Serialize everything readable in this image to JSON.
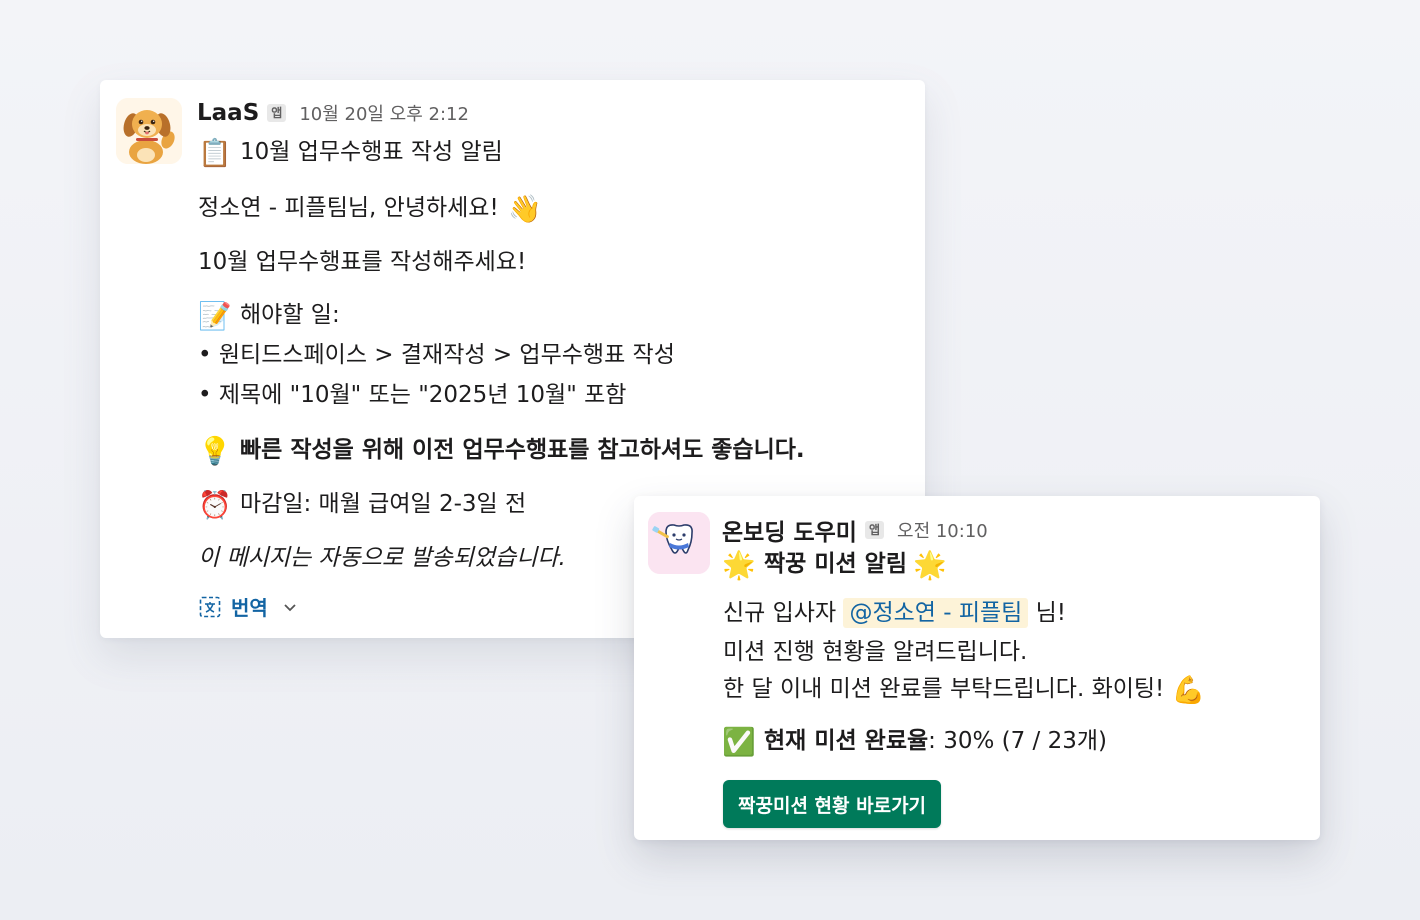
{
  "laas": {
    "sender": "LaaS",
    "app_badge": "앱",
    "time": "10월 20일 오후 2:12",
    "title_emoji": "📋",
    "title": "10월 업무수행표 작성 알림",
    "greeting": "정소연 - 피플팀님, 안녕하세요!",
    "greeting_emoji": "👋",
    "request": "10월 업무수행표를 작성해주세요!",
    "todo_emoji": "📝",
    "todo_label": "해야할 일:",
    "bullets": [
      "• 원티드스페이스 > 결재작성 > 업무수행표 작성",
      "• 제목에 \"10월\" 또는 \"2025년 10월\" 포함"
    ],
    "tip_emoji": "💡",
    "tip": "빠른 작성을 위해 이전 업무수행표를 참고하셔도 좋습니다.",
    "deadline_emoji": "⏰",
    "deadline": "마감일: 매월 급여일 2-3일 전",
    "auto_note": "이 메시지는 자동으로 발송되었습니다.",
    "translate_label": "번역",
    "translate_icon": "translate-icon",
    "dropdown_icon": "chevron-down-icon"
  },
  "onboard": {
    "sender": "온보딩 도우미",
    "app_badge": "앱",
    "time": "오전 10:10",
    "star_emoji": "🌟",
    "title": "짝꿍 미션 알림",
    "intro_prefix": "신규 입사자",
    "mention": "@정소연 - 피플팀",
    "intro_suffix": "님!",
    "line2": "미션 진행 현황을 알려드립니다.",
    "line3": "한 달 이내 미션 완료를 부탁드립니다. 화이팅!",
    "muscle_emoji": "💪",
    "check_emoji": "✅",
    "status_label": "현재 미션 완료율",
    "status_value": ": 30% (7 / 23개)",
    "button_label": "짝꿍미션 현황 바로가기"
  },
  "colors": {
    "accent_button": "#007a5a",
    "link": "#1264a3",
    "mention_bg": "#fdf3d8"
  }
}
